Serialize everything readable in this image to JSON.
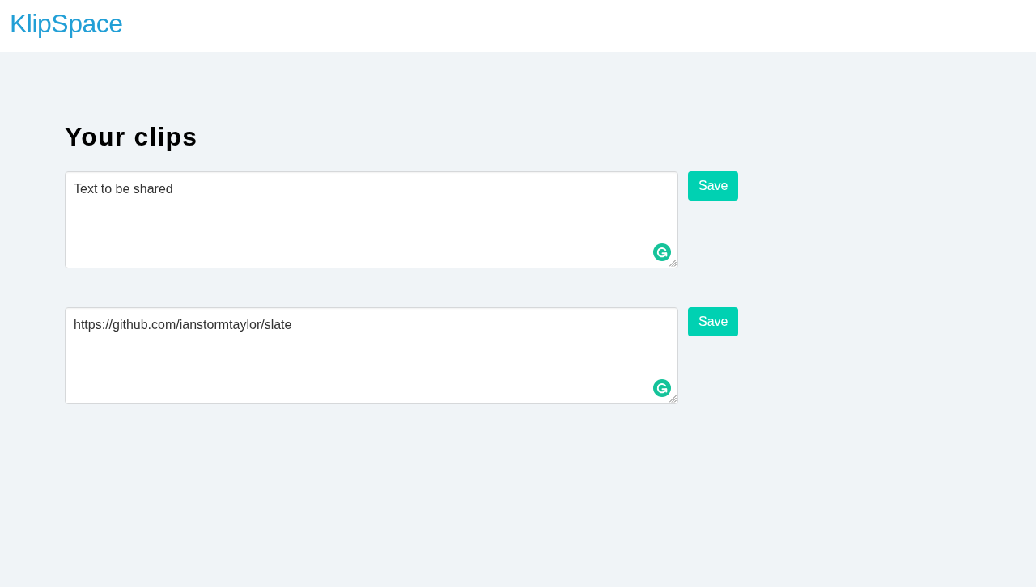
{
  "header": {
    "logo": "KlipSpace"
  },
  "page": {
    "title": "Your clips"
  },
  "clips": [
    {
      "text": "Text to be shared",
      "button": "Save"
    },
    {
      "text": "https://github.com/ianstormtaylor/slate",
      "button": "Save"
    }
  ]
}
